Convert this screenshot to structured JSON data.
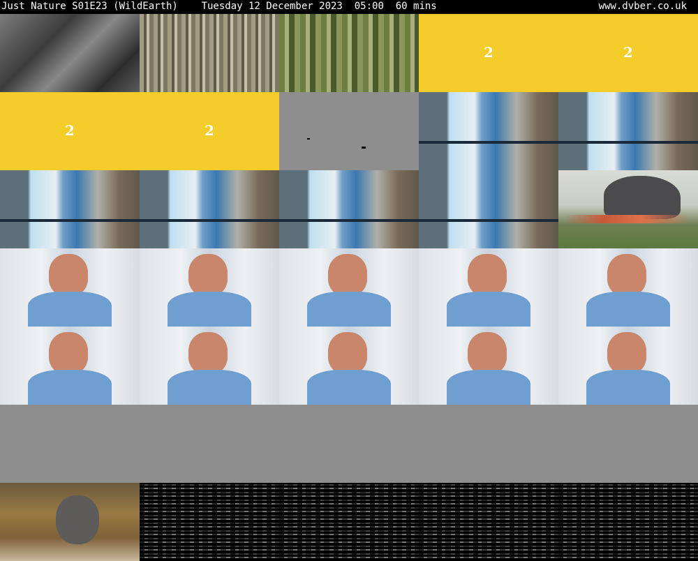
{
  "header": {
    "title": "Just Nature S01E23 (WildEarth)    Tuesday 12 December 2023  05:00  60 mins",
    "site": "www.dvber.co.uk"
  },
  "grid": {
    "rows": [
      [
        "car",
        "strips",
        "green",
        "yellow-2",
        "yellow-2"
      ],
      [
        "yellow-2",
        "yellow-2",
        "gray-frame",
        "office",
        "office"
      ],
      [
        "office",
        "office",
        "office",
        "office",
        "elephant"
      ],
      [
        "host",
        "host",
        "host",
        "host",
        "host"
      ],
      [
        "host",
        "host",
        "host",
        "host",
        "host"
      ],
      [
        "gray",
        "gray",
        "gray",
        "gray",
        "gray"
      ],
      [
        "forest-elephant",
        "noise",
        "noise",
        "noise",
        "noise"
      ]
    ],
    "yellow_label": "2",
    "colors": {
      "yellow": "#f4cd2a",
      "gray": "#8e8e8e",
      "background": "#000000"
    }
  }
}
